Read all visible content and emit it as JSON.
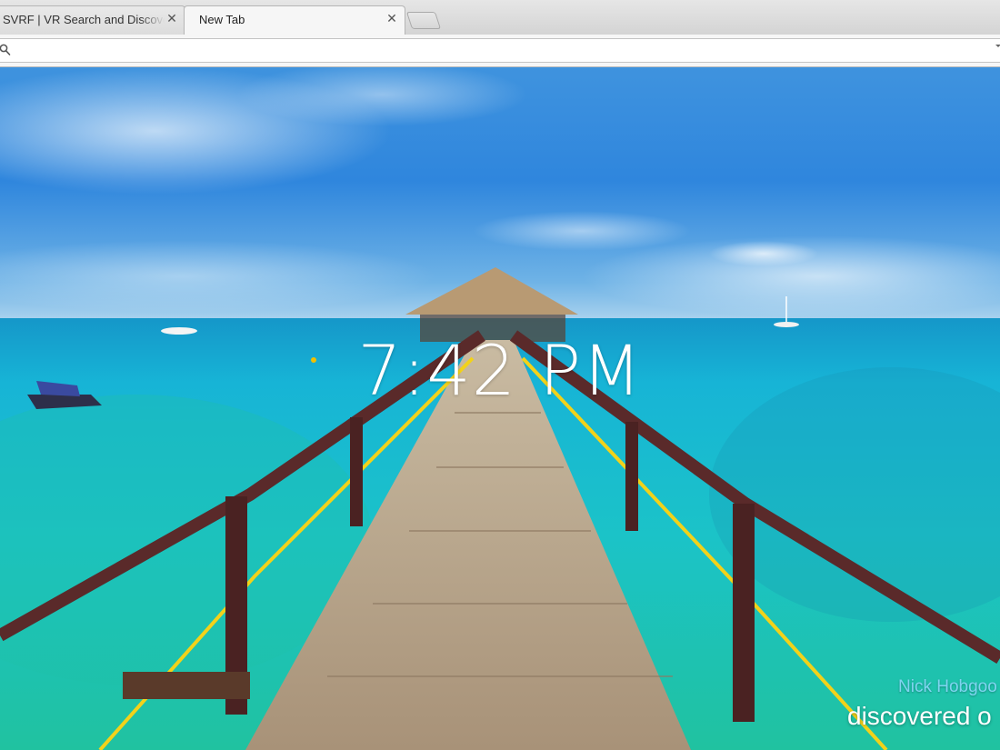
{
  "browser": {
    "tabs": [
      {
        "title": "SVRF | VR Search and Discove",
        "close_label": "✕"
      },
      {
        "title": "New Tab",
        "close_label": "✕"
      }
    ],
    "omnibox": {
      "value": "",
      "icon": "search-icon"
    }
  },
  "new_tab": {
    "clock": "7:42 PM",
    "credit": {
      "name": "Nick Hobgoo",
      "discovered": "discovered o"
    },
    "colors": {
      "credit_name": "#7fd4f0",
      "clock": "#ffffff"
    }
  }
}
